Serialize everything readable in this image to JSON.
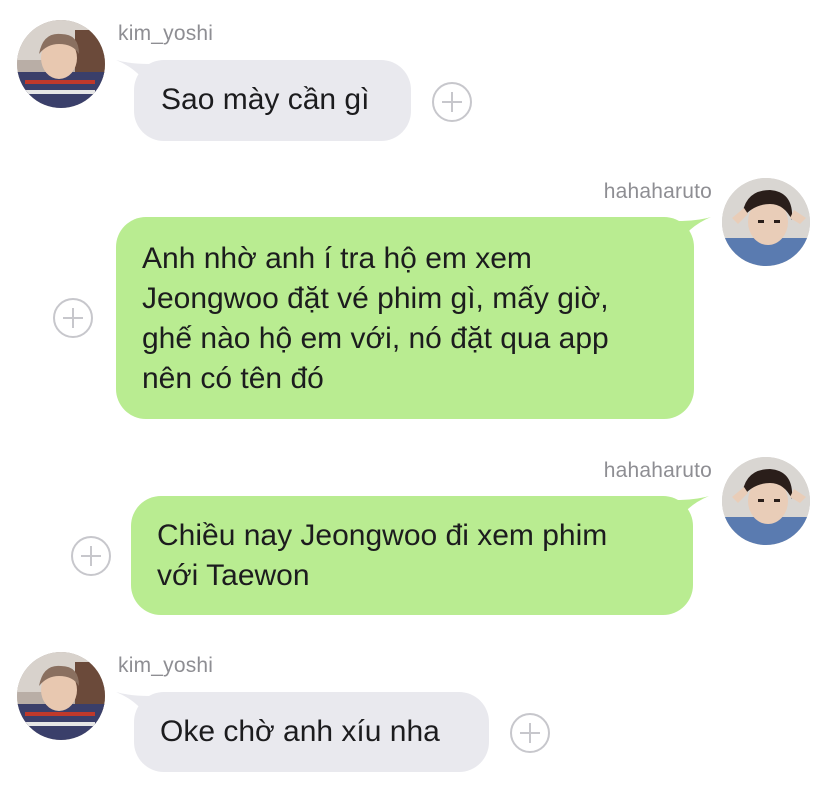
{
  "colors": {
    "incoming_bubble": "#e9e9ee",
    "outgoing_bubble": "#b9ec91",
    "username": "#8e8e93",
    "plus_icon": "#c7c7cc"
  },
  "messages": [
    {
      "sender": "kim_yoshi",
      "direction": "incoming",
      "lines": [
        "Sao mày cần gì"
      ]
    },
    {
      "sender": "hahaharuto",
      "direction": "outgoing",
      "lines": [
        "Anh nhờ anh í tra hộ em xem",
        "Jeongwoo đặt vé phim gì, mấy giờ,",
        "ghế nào hộ em với, nó đặt qua app",
        "nên có tên đó"
      ]
    },
    {
      "sender": "hahaharuto",
      "direction": "outgoing",
      "lines": [
        "Chiều nay Jeongwoo đi xem phim",
        "với Taewon"
      ]
    },
    {
      "sender": "kim_yoshi",
      "direction": "incoming",
      "lines": [
        "Oke chờ anh xíu nha"
      ]
    }
  ]
}
